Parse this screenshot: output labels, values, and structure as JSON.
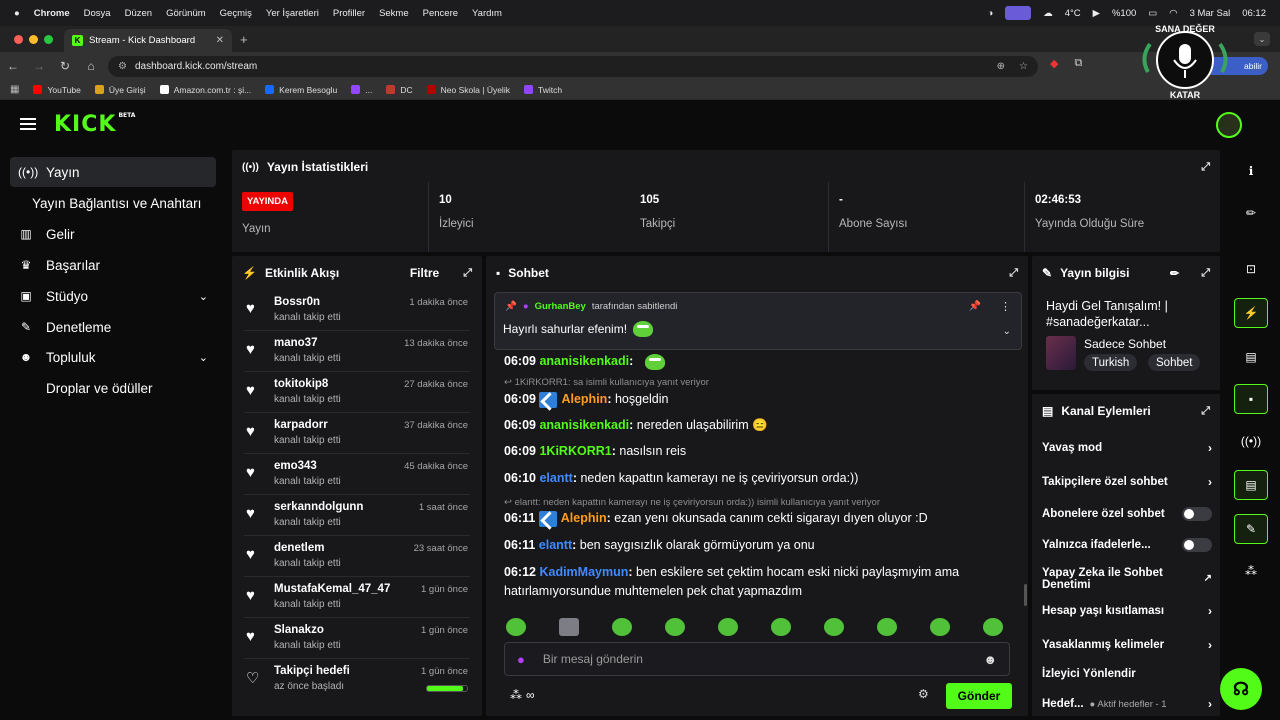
{
  "mac_menu": {
    "app": "Chrome",
    "items": [
      "Dosya",
      "Düzen",
      "Görünüm",
      "Geçmiş",
      "Yer İşaretleri",
      "Profiller",
      "Sekme",
      "Pencere",
      "Yardım"
    ],
    "weather": "4°C",
    "battery": "%100",
    "date": "3 Mar Sal",
    "time": "06:12"
  },
  "browser": {
    "tab_title": "Stream - Kick Dashboard",
    "url": "dashboard.kick.com/stream",
    "profile_label": "abilir",
    "bookmarks": [
      "YouTube",
      "Üye Girişi",
      "Amazon.com.tr : şi...",
      "Kerem Besoglu",
      "...",
      "DC",
      "Neo Skola | Üyelik",
      "Twitch"
    ]
  },
  "watermark": {
    "line1": "SANA DEĞER",
    "line2": "KATAR"
  },
  "logo": {
    "text": "KICK",
    "beta": "BETA"
  },
  "sidebar": {
    "items": [
      {
        "label": "Yayın",
        "icon": "broadcast-icon"
      },
      {
        "label": "Yayın Bağlantısı ve Anahtarı"
      },
      {
        "label": "Gelir",
        "icon": "revenue-icon"
      },
      {
        "label": "Başarılar",
        "icon": "trophy-icon"
      },
      {
        "label": "Stüdyo",
        "icon": "studio-icon"
      },
      {
        "label": "Denetleme",
        "icon": "wrench-icon"
      },
      {
        "label": "Topluluk",
        "icon": "community-icon"
      },
      {
        "label": "Droplar ve ödüller"
      }
    ]
  },
  "stats": {
    "title": "Yayın İstatistikleri",
    "live_badge": "YAYINDA",
    "live_label": "Yayın",
    "viewers_value": "10",
    "viewers_label": "İzleyici",
    "followers_value": "105",
    "followers_label": "Takipçi",
    "subs_value": "-",
    "subs_label": "Abone Sayısı",
    "uptime_value": "02:46:53",
    "uptime_label": "Yayında Olduğu Süre"
  },
  "activity": {
    "title": "Etkinlik Akışı",
    "filter": "Filtre",
    "items": [
      {
        "name": "Bossr0n",
        "desc": "kanalı takip etti",
        "time": "1 dakika önce"
      },
      {
        "name": "mano37",
        "desc": "kanalı takip etti",
        "time": "13 dakika önce"
      },
      {
        "name": "tokitokip8",
        "desc": "kanalı takip etti",
        "time": "27 dakika önce"
      },
      {
        "name": "karpadorr",
        "desc": "kanalı takip etti",
        "time": "37 dakika önce"
      },
      {
        "name": "emo343",
        "desc": "kanalı takip etti",
        "time": "45 dakika önce"
      },
      {
        "name": "serkanndolgunn",
        "desc": "kanalı takip etti",
        "time": "1 saat önce"
      },
      {
        "name": "denetlem",
        "desc": "kanalı takip etti",
        "time": "23 saat önce"
      },
      {
        "name": "MustafaKemal_47_47",
        "desc": "kanalı takip etti",
        "time": "1 gün önce"
      },
      {
        "name": "Slanakzo",
        "desc": "kanalı takip etti",
        "time": "1 gün önce"
      },
      {
        "name": "Takipçi hedefi",
        "desc": "az önce başladı",
        "time": "1 gün önce"
      }
    ],
    "goal_progress": 0.9
  },
  "chat": {
    "title": "Sohbet",
    "pinned_by_user": "GurhanBey",
    "pinned_by_suffix": "tarafından sabitlendi",
    "pinned_message": "Hayırlı sahurlar efenim!",
    "messages": [
      {
        "time": "06:09",
        "user": "ananisikenkadi",
        "text": "",
        "color": "#53fc18"
      },
      {
        "time": "06:09",
        "user": "Alephin",
        "text": "hoşgeldin",
        "color": "#ff9d1f"
      },
      {
        "time": "06:09",
        "user": "ananisikenkadi",
        "text": "nereden ulaşabilirim 😑",
        "color": "#53fc18"
      },
      {
        "time": "06:09",
        "user": "1KiRKORR1",
        "text": "nasılsın reis",
        "color": "#53fc18"
      },
      {
        "time": "06:10",
        "user": "elantt",
        "text": "neden kapattın kamerayı ne iş çeviriyorsun orda:))",
        "color": "#3f8bff"
      },
      {
        "time": "06:11",
        "user": "Alephin",
        "text": "ezan yenı okunsada canım cekti sigarayı dıyen oluyor :D",
        "color": "#ff9d1f"
      },
      {
        "time": "06:11",
        "user": "elantt",
        "text": "ben saygısızlık olarak görmüyorum ya onu",
        "color": "#3f8bff"
      },
      {
        "time": "06:12",
        "user": "KadimMaymun",
        "text": "ben eskilere set çektim hocam eski nicki paylaşmıyim ama hatırlamıyorsundue muhtemelen pek chat yapmazdım",
        "color": "#3f8bff"
      }
    ],
    "reply1": "1KiRKORR1: sa isimli kullanıcıya yanıt veriyor",
    "reply2": "elantt: neden kapattın kamerayı ne iş çeviriyorsun orda:)) isimli kullanıcıya yanıt veriyor",
    "input_placeholder": "Bir mesaj gönderin",
    "send_label": "Gönder"
  },
  "stream_info": {
    "title": "Yayın bilgisi",
    "stream_title": "Haydi Gel Tanışalım! | #sanadeğerkatar...",
    "category": "Sadece Sohbet",
    "tags": [
      "Turkish",
      "Sohbet"
    ]
  },
  "channel_actions": {
    "title": "Kanal Eylemleri",
    "rows": [
      {
        "label": "Yavaş mod",
        "type": "arrow"
      },
      {
        "label": "Takipçilere özel sohbet",
        "type": "arrow"
      },
      {
        "label": "Abonelere özel sohbet",
        "type": "toggle"
      },
      {
        "label": "Yalnızca ifadelerle...",
        "type": "toggle"
      },
      {
        "label": "Yapay Zeka ile Sohbet Denetimi",
        "type": "external"
      },
      {
        "label": "Hesap yaşı kısıtlaması",
        "type": "arrow"
      },
      {
        "label": "Yasaklanmış kelimeler",
        "type": "arrow"
      },
      {
        "label": "İzleyici Yönlendir",
        "type": "none"
      },
      {
        "label": "Hedef...",
        "type": "arrow"
      }
    ],
    "goal_sub": "Aktif hedefler - 1"
  },
  "colors": {
    "accent": "#53fc18",
    "live": "#eb0400",
    "panel": "#18181b"
  }
}
